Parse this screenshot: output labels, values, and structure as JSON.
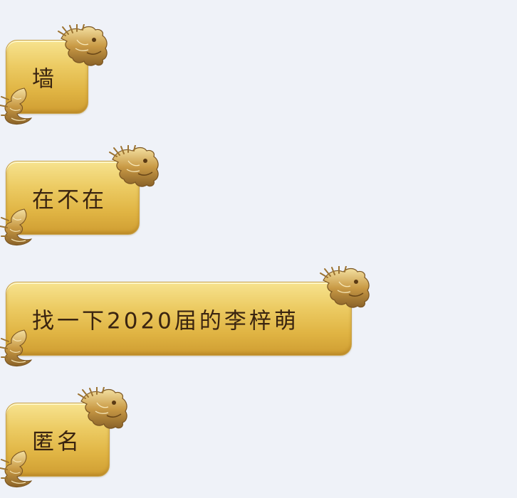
{
  "messages": [
    {
      "text": "墙"
    },
    {
      "text": "在不在"
    },
    {
      "text": "找一下2020届的李梓萌"
    },
    {
      "text": "匿名"
    }
  ],
  "theme": {
    "background": "#eff2f8",
    "bubble_gold": "#e0b443",
    "text_color": "#3a2410"
  },
  "icons": [
    "gold-dragon-head-icon",
    "gold-dragon-tail-icon"
  ]
}
